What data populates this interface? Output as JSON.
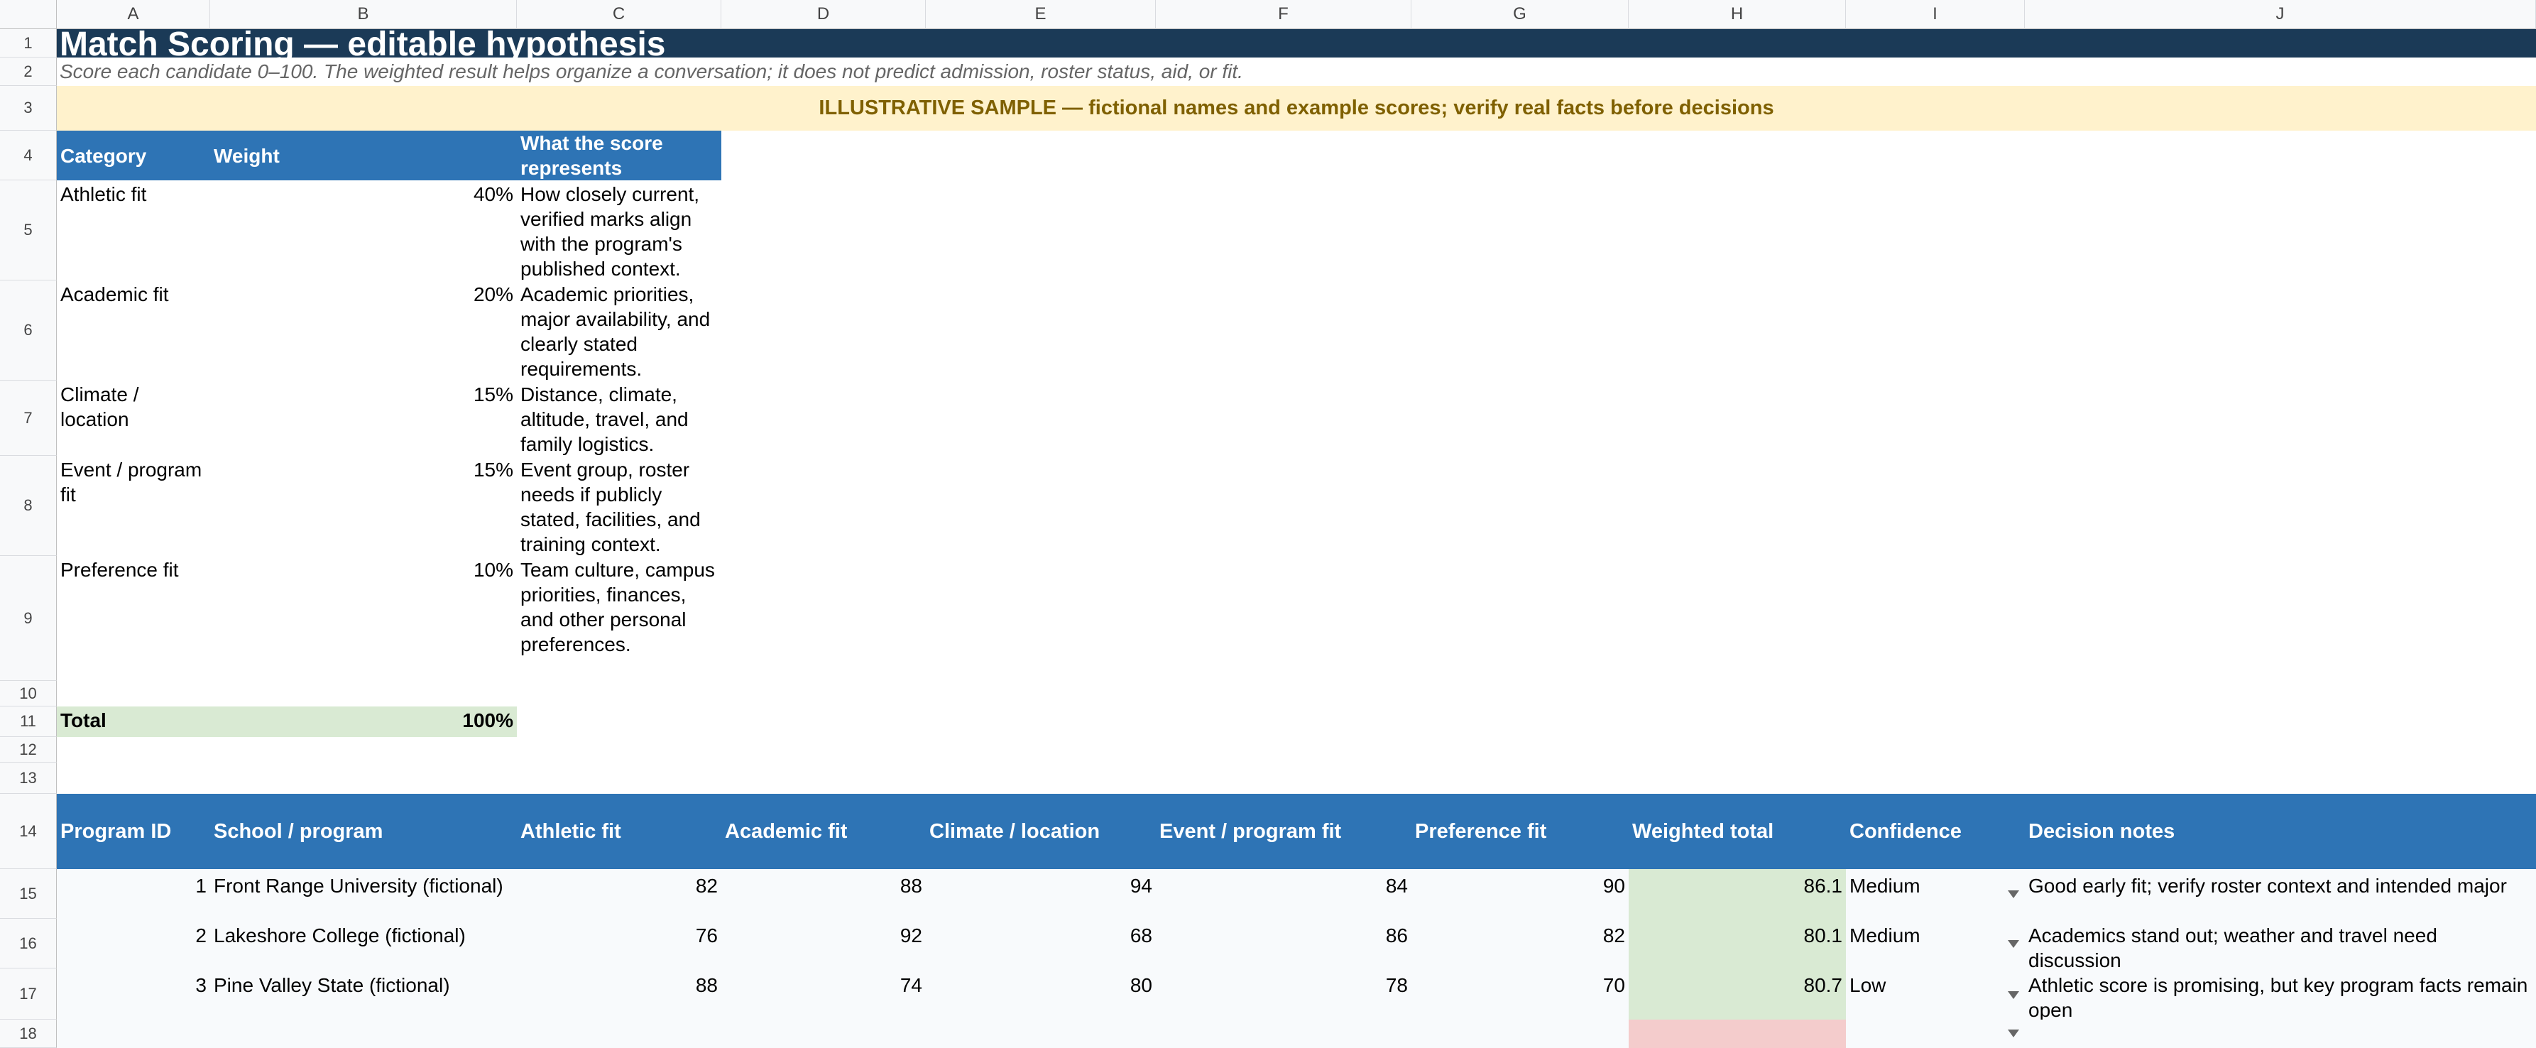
{
  "columns": [
    "A",
    "B",
    "C",
    "D",
    "E",
    "F",
    "G",
    "H",
    "I",
    "J"
  ],
  "rows": [
    "1",
    "2",
    "3",
    "4",
    "5",
    "6",
    "7",
    "8",
    "9",
    "10",
    "11",
    "12",
    "13",
    "14",
    "15",
    "16",
    "17",
    "18"
  ],
  "title": "Match Scoring — editable hypothesis",
  "subtitle": "Score each candidate 0–100. The weighted result helps organize a conversation; it does not predict admission, roster status, aid, or fit.",
  "banner": "ILLUSTRATIVE SAMPLE — fictional names and example scores; verify real facts before decisions",
  "weights": {
    "headers": [
      "Category",
      "Weight",
      "What the score represents"
    ],
    "rows": [
      {
        "category": "Athletic fit",
        "weight": "40%",
        "desc": "How closely current, verified marks align with the program's published context."
      },
      {
        "category": "Academic fit",
        "weight": "20%",
        "desc": "Academic priorities, major availability, and clearly stated requirements."
      },
      {
        "category": "Climate / location",
        "weight": "15%",
        "desc": "Distance, climate, altitude, travel, and family logistics."
      },
      {
        "category": "Event / program fit",
        "weight": "15%",
        "desc": "Event group, roster needs if publicly stated, facilities, and training context."
      },
      {
        "category": "Preference fit",
        "weight": "10%",
        "desc": "Team culture, campus priorities, finances, and other personal preferences."
      }
    ],
    "total_label": "Total",
    "total_value": "100%"
  },
  "scores": {
    "headers": [
      "Program ID",
      "School / program",
      "Athletic fit",
      "Academic fit",
      "Climate / location",
      "Event / program fit",
      "Preference fit",
      "Weighted total",
      "Confidence",
      "Decision notes"
    ],
    "rows": [
      {
        "id": "1",
        "school": "Front Range University (fictional)",
        "athletic": "82",
        "academic": "88",
        "climate": "94",
        "event": "84",
        "preference": "90",
        "total": "86.1",
        "confidence": "Medium",
        "notes": "Good early fit; verify roster context and intended major"
      },
      {
        "id": "2",
        "school": "Lakeshore College (fictional)",
        "athletic": "76",
        "academic": "92",
        "climate": "68",
        "event": "86",
        "preference": "82",
        "total": "80.1",
        "confidence": "Medium",
        "notes": "Academics stand out; weather and travel need discussion"
      },
      {
        "id": "3",
        "school": "Pine Valley State (fictional)",
        "athletic": "88",
        "academic": "74",
        "climate": "80",
        "event": "78",
        "preference": "70",
        "total": "80.7",
        "confidence": "Low",
        "notes": "Athletic score is promising, but key program facts remain open"
      }
    ]
  },
  "colors": {
    "title_bg": "#1b3a57",
    "header_bg": "#2e74b5",
    "banner_bg": "#fff2cc",
    "banner_text": "#7f6000",
    "total_bg": "#d9ead3",
    "score_area_bg": "#f8fafc",
    "invalid_bg": "#f4cccc"
  },
  "icons": {
    "dropdown": "dropdown-arrow-icon"
  }
}
